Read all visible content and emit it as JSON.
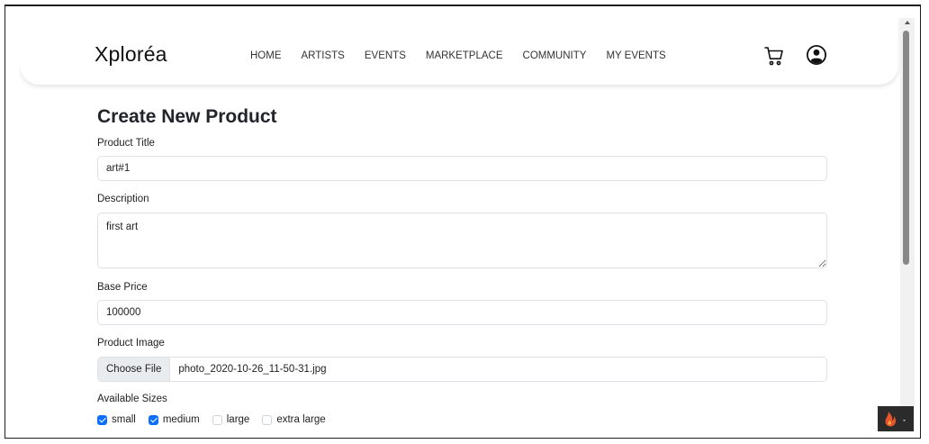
{
  "brand": "Xploréa",
  "nav": {
    "links": [
      "HOME",
      "ARTISTS",
      "EVENTS",
      "MARKETPLACE",
      "COMMUNITY",
      "MY EVENTS"
    ]
  },
  "icons": {
    "cart": "cart-icon",
    "account": "user-circle-icon",
    "flame": "flame-icon"
  },
  "form": {
    "heading": "Create New Product",
    "title_label": "Product Title",
    "title_value": "art#1",
    "description_label": "Description",
    "description_value": "first art",
    "price_label": "Base Price",
    "price_value": "100000",
    "image_label": "Product Image",
    "file_button": "Choose File",
    "file_name": "photo_2020-10-26_11-50-31.jpg",
    "sizes_label": "Available Sizes",
    "sizes": [
      {
        "label": "small",
        "checked": true
      },
      {
        "label": "medium",
        "checked": true
      },
      {
        "label": "large",
        "checked": false
      },
      {
        "label": "extra large",
        "checked": false
      }
    ]
  },
  "colors": {
    "accent": "#0d6efd",
    "flame": "#e8552b"
  }
}
